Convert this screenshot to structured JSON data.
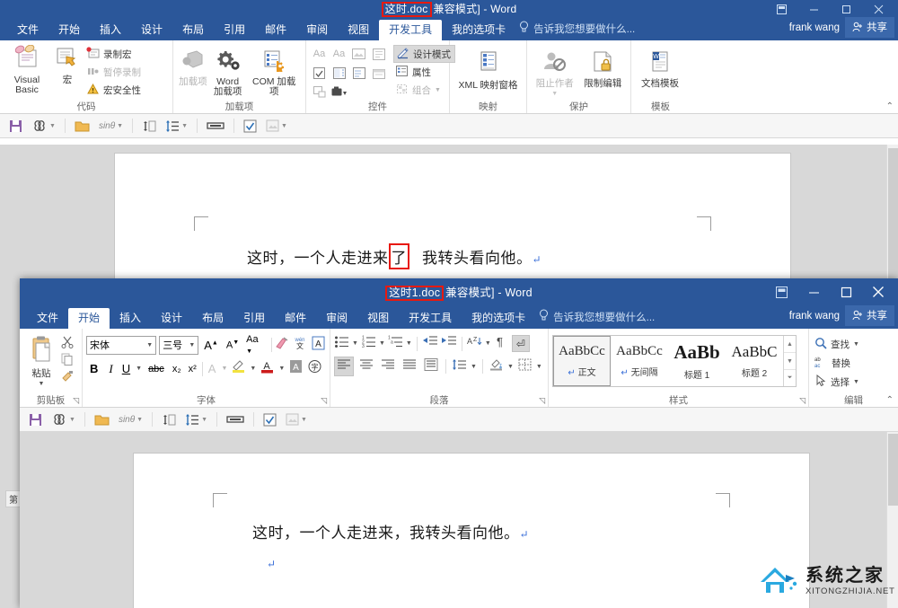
{
  "back_window": {
    "title": {
      "filename": "这时.doc",
      "suffix": "兼容模式] - Word"
    },
    "tabs": [
      {
        "label": "文件",
        "active": false
      },
      {
        "label": "开始",
        "active": false
      },
      {
        "label": "插入",
        "active": false
      },
      {
        "label": "设计",
        "active": false
      },
      {
        "label": "布局",
        "active": false
      },
      {
        "label": "引用",
        "active": false
      },
      {
        "label": "邮件",
        "active": false
      },
      {
        "label": "审阅",
        "active": false
      },
      {
        "label": "视图",
        "active": false
      },
      {
        "label": "开发工具",
        "active": true
      },
      {
        "label": "我的选项卡",
        "active": false
      }
    ],
    "tell_me": "告诉我您想要做什么...",
    "user": "frank wang",
    "share": "共享",
    "ribbon_groups": [
      {
        "label": "代码",
        "big_buttons": [
          {
            "label": "Visual Basic",
            "icon": "visual-basic-icon"
          },
          {
            "label": "宏",
            "icon": "macro-icon"
          }
        ],
        "small_buttons": [
          {
            "label": "录制宏",
            "icon": "record-macro-icon",
            "disabled": false
          },
          {
            "label": "暂停录制",
            "icon": "pause-record-icon",
            "disabled": true
          },
          {
            "label": "宏安全性",
            "icon": "macro-security-icon",
            "disabled": false
          }
        ]
      },
      {
        "label": "加载项",
        "big_buttons": [
          {
            "label": "加载项",
            "icon": "addin-icon",
            "disabled": true
          },
          {
            "label": "Word 加载项",
            "icon": "word-addin-icon"
          },
          {
            "label": "COM 加载项",
            "icon": "com-addin-icon"
          }
        ],
        "small_buttons": []
      },
      {
        "label": "控件",
        "big_buttons": [],
        "small_buttons": [
          {
            "label": "设计模式",
            "icon": "design-mode-icon",
            "selected": true
          },
          {
            "label": "属性",
            "icon": "properties-icon",
            "disabled": false
          },
          {
            "label": "组合",
            "icon": "group-icon",
            "disabled": true
          }
        ]
      },
      {
        "label": "映射",
        "big_buttons": [
          {
            "label": "XML 映射窗格",
            "icon": "xml-mapping-icon"
          }
        ],
        "small_buttons": []
      },
      {
        "label": "保护",
        "big_buttons": [
          {
            "label": "阻止作者",
            "icon": "block-authors-icon",
            "disabled": true
          },
          {
            "label": "限制编辑",
            "icon": "restrict-edit-icon"
          }
        ],
        "small_buttons": []
      },
      {
        "label": "模板",
        "big_buttons": [
          {
            "label": "文档模板",
            "icon": "document-template-icon"
          }
        ],
        "small_buttons": []
      }
    ],
    "addin_toolbar": [
      {
        "icon": "save-icon"
      },
      {
        "icon": "infinity-icon",
        "dropdown": true
      },
      {
        "icon": "folder-icon"
      },
      {
        "icon": "sin-theta-icon",
        "label": "sinθ",
        "dropdown": true
      },
      {
        "icon": "line-spacing-icon"
      },
      {
        "icon": "paragraph-spacing-icon",
        "dropdown": true
      },
      {
        "icon": "bracket-icon"
      },
      {
        "icon": "checkbox-icon"
      },
      {
        "icon": "image-icon",
        "dropdown": true
      }
    ],
    "document": {
      "text_before": "这时，一个人走进来",
      "text_highlight": "了",
      "text_after": "我转头看向他。",
      "pilcrow": "↵"
    },
    "status_left": "第"
  },
  "front_window": {
    "title": {
      "filename": "这时1.doc",
      "suffix": "兼容模式] - Word"
    },
    "tabs": [
      {
        "label": "文件",
        "active": false
      },
      {
        "label": "开始",
        "active": true
      },
      {
        "label": "插入",
        "active": false
      },
      {
        "label": "设计",
        "active": false
      },
      {
        "label": "布局",
        "active": false
      },
      {
        "label": "引用",
        "active": false
      },
      {
        "label": "邮件",
        "active": false
      },
      {
        "label": "审阅",
        "active": false
      },
      {
        "label": "视图",
        "active": false
      },
      {
        "label": "开发工具",
        "active": false
      },
      {
        "label": "我的选项卡",
        "active": false
      }
    ],
    "tell_me": "告诉我您想要做什么...",
    "user": "frank wang",
    "share": "共享",
    "clipboard": {
      "label": "剪贴板",
      "paste_label": "粘贴",
      "cut_icon": "cut-icon",
      "copy_icon": "copy-icon",
      "format_painter_icon": "format-painter-icon"
    },
    "font_group": {
      "label": "字体",
      "font_name": "宋体",
      "font_size": "三号",
      "buttons": [
        "grow-font-icon",
        "shrink-font-icon",
        "change-case-icon",
        "clear-formatting-icon",
        "phonetic-guide-icon",
        "character-border-icon",
        "bold-icon",
        "italic-icon",
        "underline-icon",
        "strikethrough-icon",
        "subscript-icon",
        "superscript-icon",
        "text-effects-icon",
        "text-highlight-icon",
        "font-color-icon",
        "character-shading-icon",
        "enclose-characters-icon"
      ],
      "bold_label": "B",
      "italic_label": "I",
      "underline_label": "U",
      "strike_label": "abc",
      "sub_label": "x₂",
      "sup_label": "x²",
      "aa_label": "Aa"
    },
    "paragraph_group": {
      "label": "段落",
      "buttons": [
        "bullets-icon",
        "numbering-icon",
        "multilevel-list-icon",
        "decrease-indent-icon",
        "increase-indent-icon",
        "sort-icon",
        "show-marks-icon",
        "align-left-icon",
        "align-center-icon",
        "align-right-icon",
        "justify-icon",
        "distribute-icon",
        "line-spacing-icon",
        "shading-icon",
        "borders-icon"
      ]
    },
    "styles_group": {
      "label": "样式",
      "items": [
        {
          "preview": "AaBbCc",
          "name": "正文",
          "selected": true
        },
        {
          "preview": "AaBbCc",
          "name": "无间隔",
          "selected": false
        },
        {
          "preview": "AaBb",
          "name": "标题 1",
          "selected": false
        },
        {
          "preview": "AaBbC",
          "name": "标题 2",
          "selected": false
        }
      ]
    },
    "editing_group": {
      "label": "编辑",
      "items": [
        {
          "label": "查找",
          "icon": "find-icon",
          "dropdown": true
        },
        {
          "label": "替换",
          "icon": "replace-icon",
          "dropdown": false
        },
        {
          "label": "选择",
          "icon": "select-icon",
          "dropdown": true
        }
      ]
    },
    "addin_toolbar": [
      {
        "icon": "save-icon"
      },
      {
        "icon": "infinity-icon",
        "dropdown": true
      },
      {
        "icon": "folder-icon"
      },
      {
        "icon": "sin-theta-icon",
        "label": "sinθ",
        "dropdown": true
      },
      {
        "icon": "line-spacing-icon"
      },
      {
        "icon": "paragraph-spacing-icon",
        "dropdown": true
      },
      {
        "icon": "bracket-icon"
      },
      {
        "icon": "checkbox-icon"
      },
      {
        "icon": "image-icon",
        "dropdown": true
      }
    ],
    "document": {
      "line1": "这时，一个人走进来，我转头看向他。",
      "pilcrow": "↵",
      "line2_pilcrow": "↵"
    }
  },
  "watermark": {
    "cn": "系统之家",
    "en": "XITONGZHIJIA.NET"
  },
  "colors": {
    "word_blue": "#2b579a",
    "red_box": "#e8190f",
    "ribbon_bg": "#ffffff",
    "canvas_gray": "#d8d8d8"
  }
}
